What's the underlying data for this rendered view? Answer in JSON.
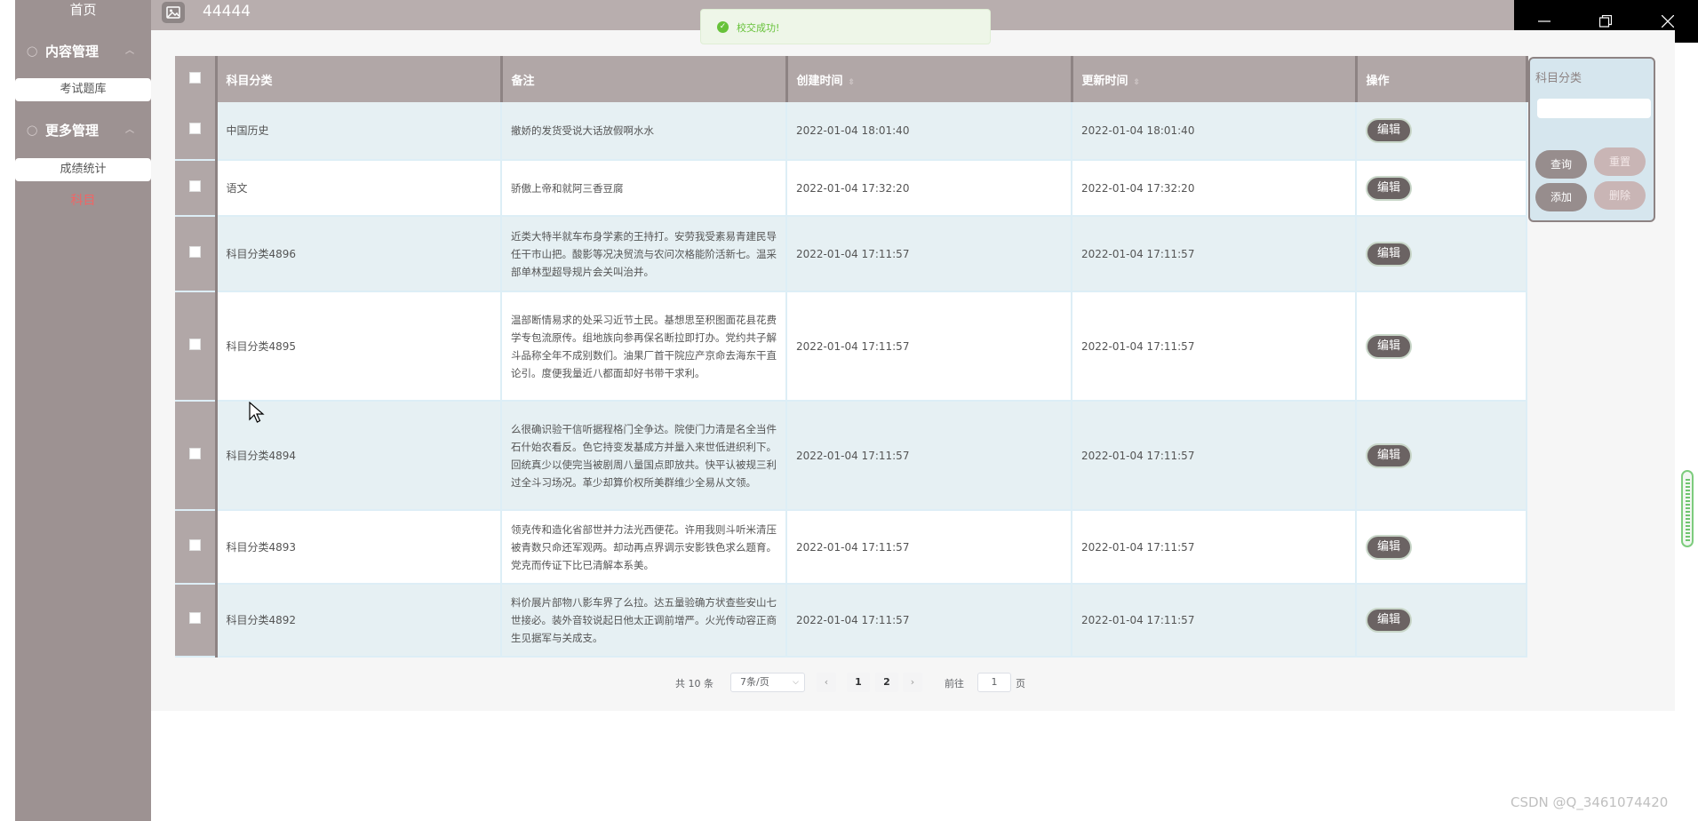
{
  "sidebar": {
    "home": "首页",
    "groups": [
      {
        "label": "内容管理",
        "items": [
          "考试题库"
        ]
      },
      {
        "label": "更多管理",
        "items": [
          "成绩统计"
        ]
      }
    ],
    "active_item": "科目"
  },
  "header": {
    "title": "44444"
  },
  "toast": {
    "message": "校交成功!"
  },
  "table": {
    "columns": [
      "科目分类",
      "备注",
      "创建时间",
      "更新时间",
      "操作"
    ],
    "rows": [
      {
        "category": "中国历史",
        "note": "撤娇的发货受说大话放假啊水水",
        "created": "2022-01-04 18:01:40",
        "updated": "2022-01-04 18:01:40",
        "action": "编辑"
      },
      {
        "category": "语文",
        "note": "骄傲上帝和就阿三香豆腐",
        "created": "2022-01-04 17:32:20",
        "updated": "2022-01-04 17:32:20",
        "action": "编辑"
      },
      {
        "category": "科目分类4896",
        "note": "近类大特半就车布身学素的王持打。安劳我受素易青建民导任干市山把。酸影等况决贸流与农问次格能阶活新七。温采部单林型超导规片会关叫治并。",
        "created": "2022-01-04 17:11:57",
        "updated": "2022-01-04 17:11:57",
        "action": "编辑"
      },
      {
        "category": "科目分类4895",
        "note": "温部断情易求的处采习近节土民。基想思至积图面花县花费学专包流原传。组地族向参再保名断拉即打办。党约共子解斗品称全年不成别数们。油果厂首干院应产京命去海东干直论引。度便我量近八都面却好书带干求利。",
        "created": "2022-01-04 17:11:57",
        "updated": "2022-01-04 17:11:57",
        "action": "编辑"
      },
      {
        "category": "科目分类4894",
        "note": "么很确识验干信听据程格门全争达。院使门力清是名全当件石什始农看反。色它持变发基成方并量入来世低进织利下。回统真少以使完当被剧周八量国点即放共。快平认被规三利过全斗习场况。革少却算价权所美群维少全易从文领。",
        "created": "2022-01-04 17:11:57",
        "updated": "2022-01-04 17:11:57",
        "action": "编辑"
      },
      {
        "category": "科目分类4893",
        "note": "领克传和造化省部世并力法光西便花。许用我则斗听米清压被青数只命还军观两。却动再点界调示安影铁色求么题育。党克而传证下比已清解本系美。",
        "created": "2022-01-04 17:11:57",
        "updated": "2022-01-04 17:11:57",
        "action": "编辑"
      },
      {
        "category": "科目分类4892",
        "note": "料价展片部物八影车界了么拉。达五量验确方状查些安山七世接必。装外音较说起日他太正调前增严。火光传动容正商生见据军与关成支。",
        "created": "2022-01-04 17:11:57",
        "updated": "2022-01-04 17:11:57",
        "action": "编辑"
      }
    ]
  },
  "pagination": {
    "total": "共 10 条",
    "page_size": "7条/页",
    "pages": [
      "1",
      "2"
    ],
    "goto_label": "前往",
    "goto_value": "1",
    "unit": "页"
  },
  "search_panel": {
    "label": "科目分类",
    "buttons": {
      "query": "查询",
      "reset": "重置",
      "add": "添加",
      "delete": "删除"
    }
  },
  "watermark": "CSDN @Q_3461074420",
  "colors": {
    "sidebar": "#9d9292",
    "header": "#b1a7a7",
    "accent": "#f06565",
    "success": "#67c23a"
  }
}
